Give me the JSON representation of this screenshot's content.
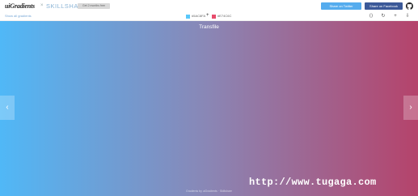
{
  "header": {
    "logo_text": "uiGradients",
    "logo_separator": "×",
    "partner_text": "SKILLSHARE",
    "grey_button_label": "Get 2 months free",
    "share_twitter_label": "Share on Twitter",
    "share_facebook_label": "Share on Facebook",
    "github_icon": "github-icon"
  },
  "subbar": {
    "path_text": "Show all gradients",
    "color_a": {
      "hex": "#5AC8FA",
      "label": "#5AC8FA"
    },
    "plus": "+",
    "color_b": {
      "hex": "#E74C6C",
      "label": "#E74C6C"
    },
    "tools": [
      {
        "icon": "code-icon",
        "glyph": "⟨⟩"
      },
      {
        "icon": "rotate-icon",
        "glyph": "↻"
      },
      {
        "icon": "add-icon",
        "glyph": "+"
      },
      {
        "icon": "download-icon",
        "glyph": "⇩"
      }
    ]
  },
  "gradient": {
    "title": "Transfile",
    "colors": [
      "#50B8F7",
      "#B5436B"
    ],
    "prev_glyph": "‹",
    "next_glyph": "›",
    "footer_note": "Gradients by uiGradients · Skillshare"
  },
  "watermark": {
    "text": "http://www.tugaga.com"
  }
}
